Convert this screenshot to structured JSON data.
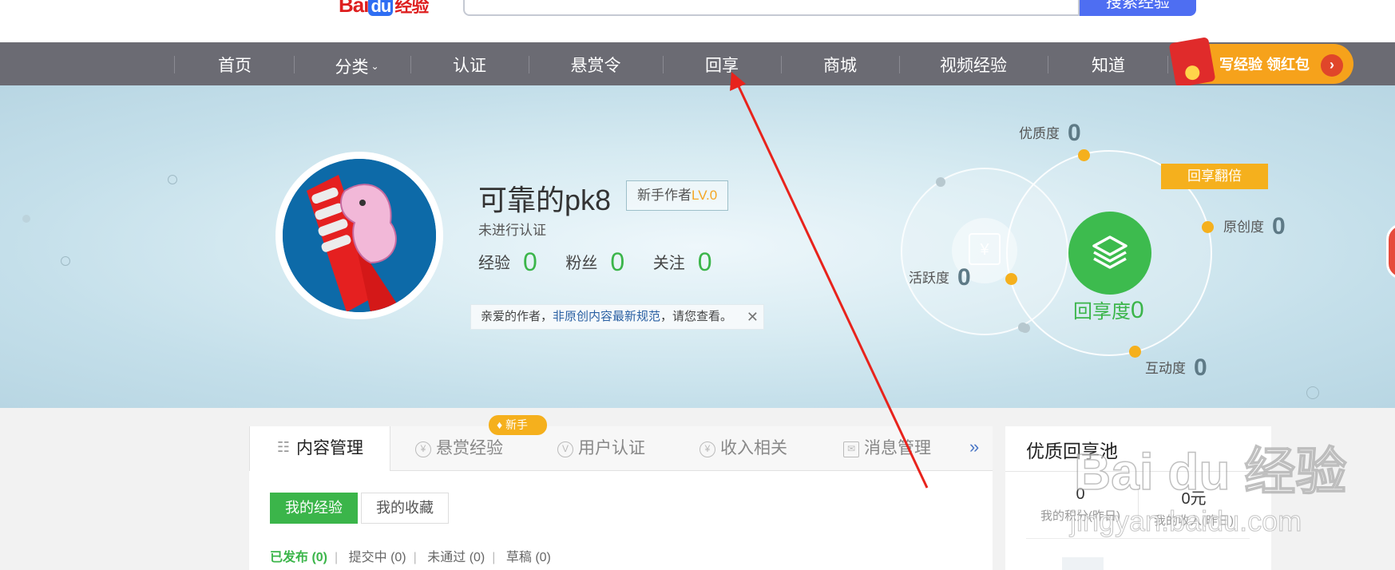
{
  "header": {
    "logo_bai": "Bai",
    "logo_du": "du",
    "logo_jingyan": "经验",
    "search_button": "搜索经验"
  },
  "nav": {
    "items": [
      {
        "label": "首页"
      },
      {
        "label": "分类"
      },
      {
        "label": "认证"
      },
      {
        "label": "悬赏令"
      },
      {
        "label": "回享"
      },
      {
        "label": "商城"
      },
      {
        "label": "视频经验"
      },
      {
        "label": "知道"
      }
    ],
    "promo": "写经验 领红包"
  },
  "profile": {
    "name": "可靠的pk8",
    "level_prefix": "新手作者",
    "level": "LV.0",
    "verify_status": "未进行认证",
    "stats": [
      {
        "label": "经验",
        "value": "0"
      },
      {
        "label": "粉丝",
        "value": "0"
      },
      {
        "label": "关注",
        "value": "0"
      }
    ],
    "notice_prefix": "亲爱的作者，",
    "notice_link": "非原创内容最新规范",
    "notice_suffix": "，请您查看。"
  },
  "metrics": {
    "quality_label": "优质度",
    "quality_value": "0",
    "original_label": "原创度",
    "original_value": "0",
    "activity_label": "活跃度",
    "activity_value": "0",
    "interaction_label": "互动度",
    "interaction_value": "0",
    "share_label": "回享度",
    "share_value": "0",
    "double_badge": "回享翻倍"
  },
  "content": {
    "tabs": [
      {
        "label": "内容管理"
      },
      {
        "label": "悬赏经验"
      },
      {
        "label": "用户认证"
      },
      {
        "label": "收入相关"
      },
      {
        "label": "消息管理"
      }
    ],
    "new_badge": "新手",
    "more": "»",
    "sub_tabs": [
      "我的经验",
      "我的收藏"
    ],
    "filters": [
      {
        "label": "已发布 (0)"
      },
      {
        "label": "提交中 (0)"
      },
      {
        "label": "未通过 (0)"
      },
      {
        "label": "草稿 (0)"
      }
    ]
  },
  "side": {
    "title": "优质回享池",
    "points_value": "0",
    "points_label": "我的积分(昨日)",
    "income_value": "0元",
    "income_label": "我的收入(昨日)"
  },
  "watermark": {
    "brand": "Bai du 经验",
    "url": "jingyan.baidu.com"
  },
  "colors": {
    "nav_bg": "#6b6b73",
    "accent_green": "#3bb54a",
    "accent_orange": "#f5b01d",
    "annotation_arrow": "#e8231c"
  }
}
